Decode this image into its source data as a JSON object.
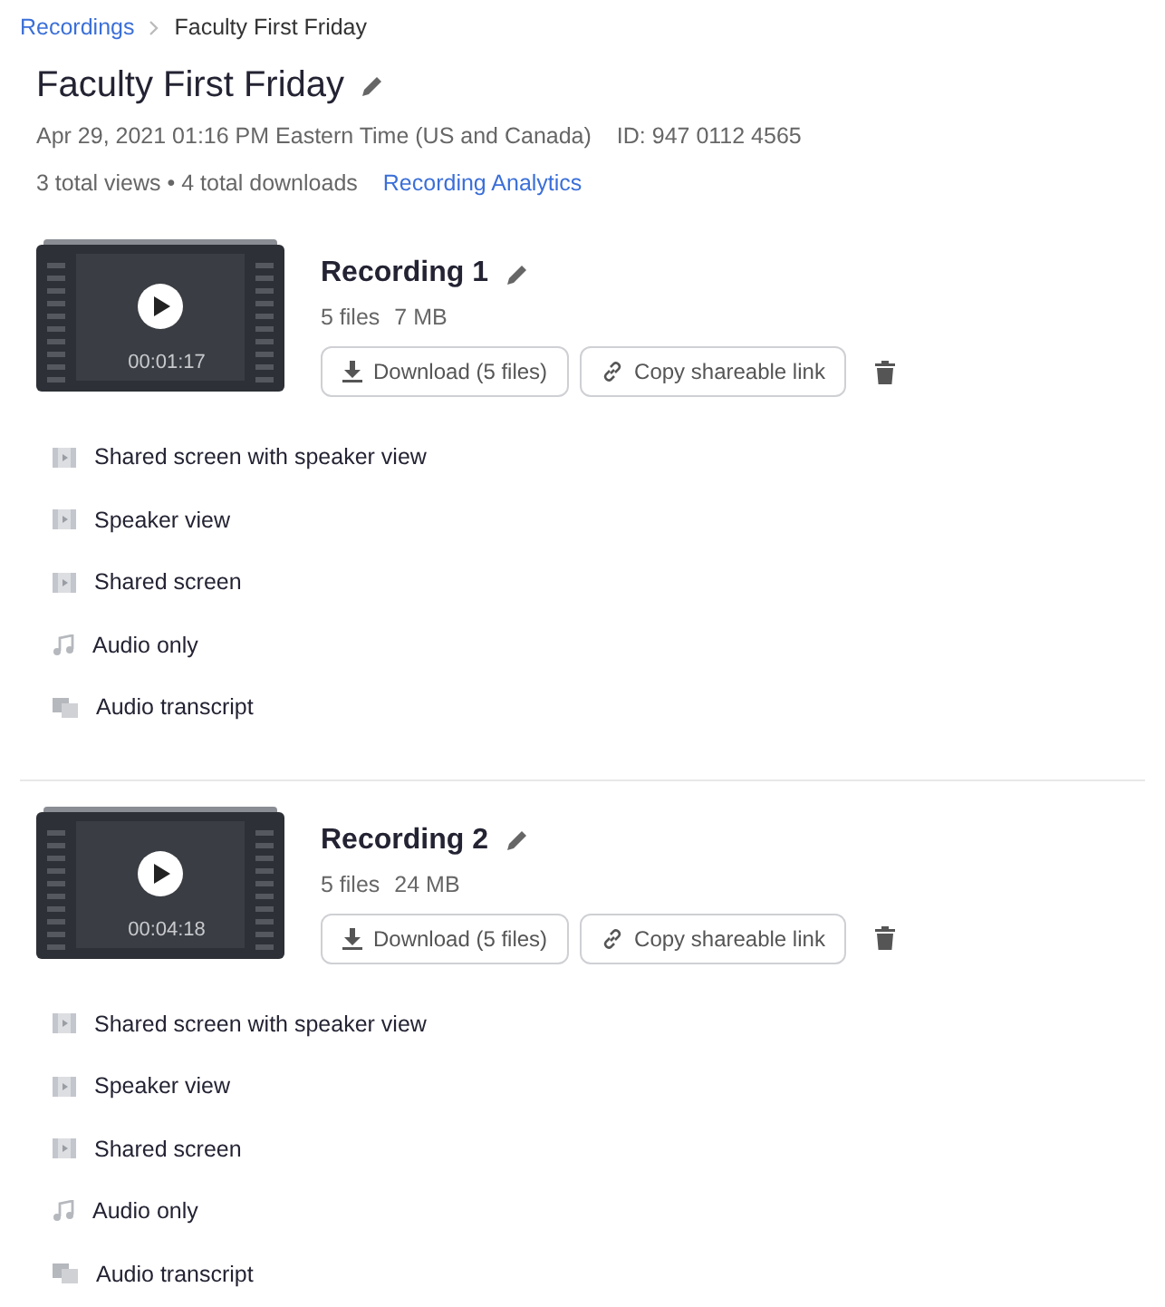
{
  "breadcrumb": [
    {
      "label": "Recordings",
      "link": true
    },
    {
      "label": "Faculty First Friday",
      "link": false
    }
  ],
  "meeting": {
    "title": "Faculty First Friday",
    "datetime": "Apr 29, 2021 01:16 PM Eastern Time (US and Canada)",
    "id": "ID: 947 0112 4565",
    "stats": "3 total views • 4 total downloads",
    "analytics_link": "Recording Analytics"
  },
  "recordings": [
    {
      "title": "Recording 1",
      "file_count": "5 files",
      "size": "7 MB",
      "duration": "00:01:17",
      "download_button": "Download (5 files)",
      "share_button": "Copy shareable link",
      "files": [
        {
          "kind": "video",
          "label": "Shared screen with speaker view"
        },
        {
          "kind": "video",
          "label": "Speaker view"
        },
        {
          "kind": "video",
          "label": "Shared screen"
        },
        {
          "kind": "audio",
          "label": "Audio only"
        },
        {
          "kind": "transcript",
          "label": "Audio transcript"
        }
      ]
    },
    {
      "title": "Recording 2",
      "file_count": "5 files",
      "size": "24 MB",
      "duration": "00:04:18",
      "download_button": "Download (5 files)",
      "share_button": "Copy shareable link",
      "files": [
        {
          "kind": "video",
          "label": "Shared screen with speaker view"
        },
        {
          "kind": "video",
          "label": "Speaker view"
        },
        {
          "kind": "video",
          "label": "Shared screen"
        },
        {
          "kind": "audio",
          "label": "Audio only"
        },
        {
          "kind": "transcript",
          "label": "Audio transcript"
        }
      ]
    }
  ]
}
